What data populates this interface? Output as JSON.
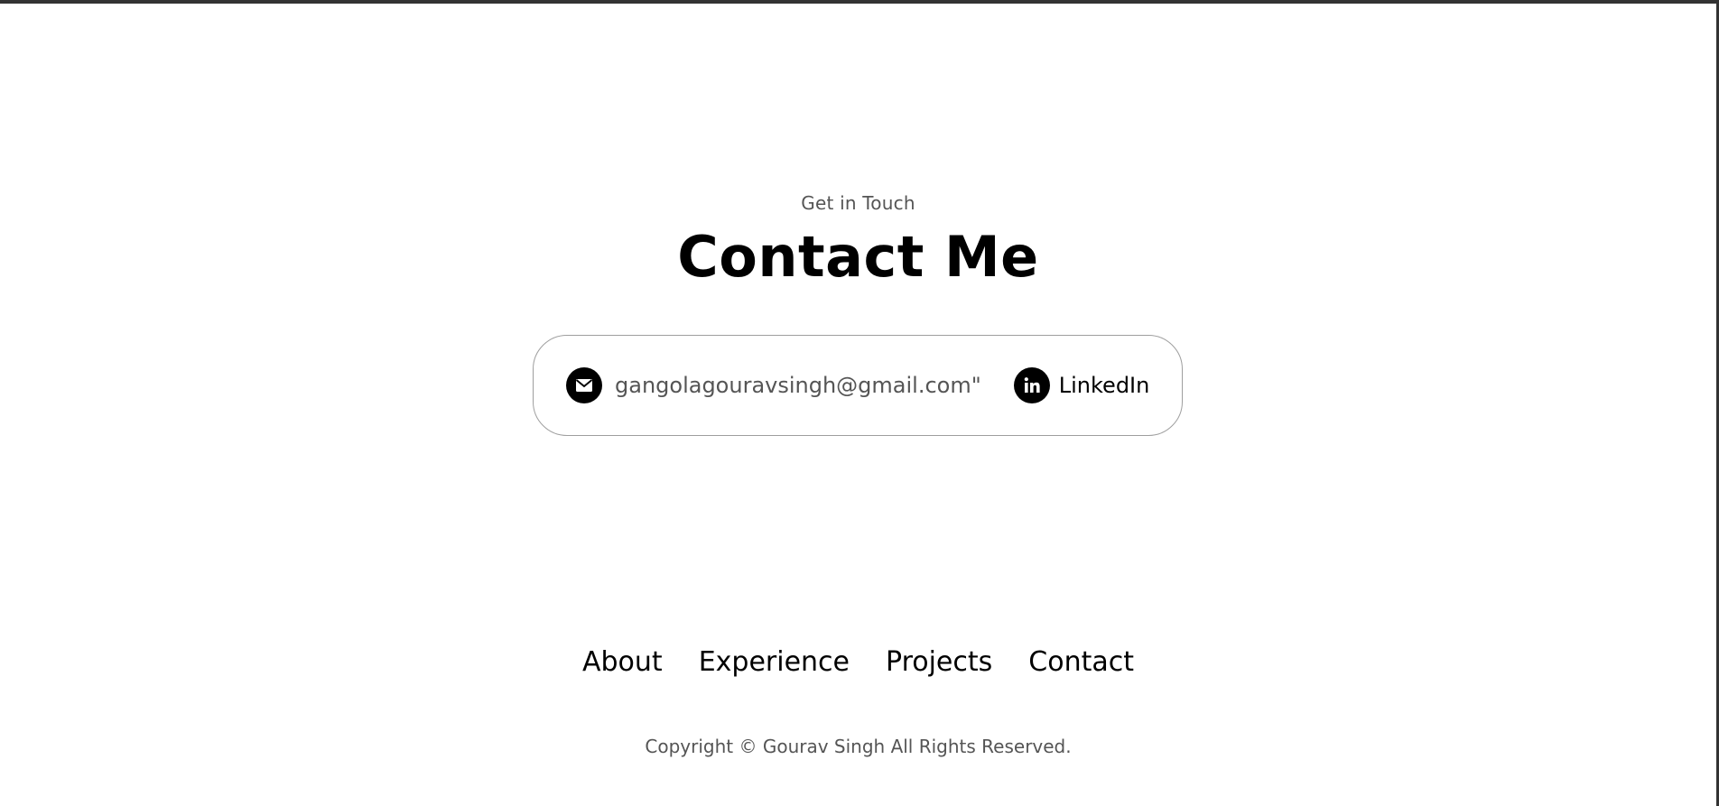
{
  "contact": {
    "subtitle": "Get in Touch",
    "title": "Contact Me",
    "email": {
      "icon": "envelope-icon",
      "text": "gangolagouravsingh@gmail.com\""
    },
    "linkedin": {
      "icon": "linkedin-icon",
      "text": "LinkedIn"
    }
  },
  "footer": {
    "nav": [
      "About",
      "Experience",
      "Projects",
      "Contact"
    ],
    "copyright": "Copyright © Gourav Singh All Rights Reserved."
  },
  "colors": {
    "text_primary": "#000000",
    "text_secondary": "#555555",
    "border": "#9e9e9e",
    "frame": "#333333"
  }
}
